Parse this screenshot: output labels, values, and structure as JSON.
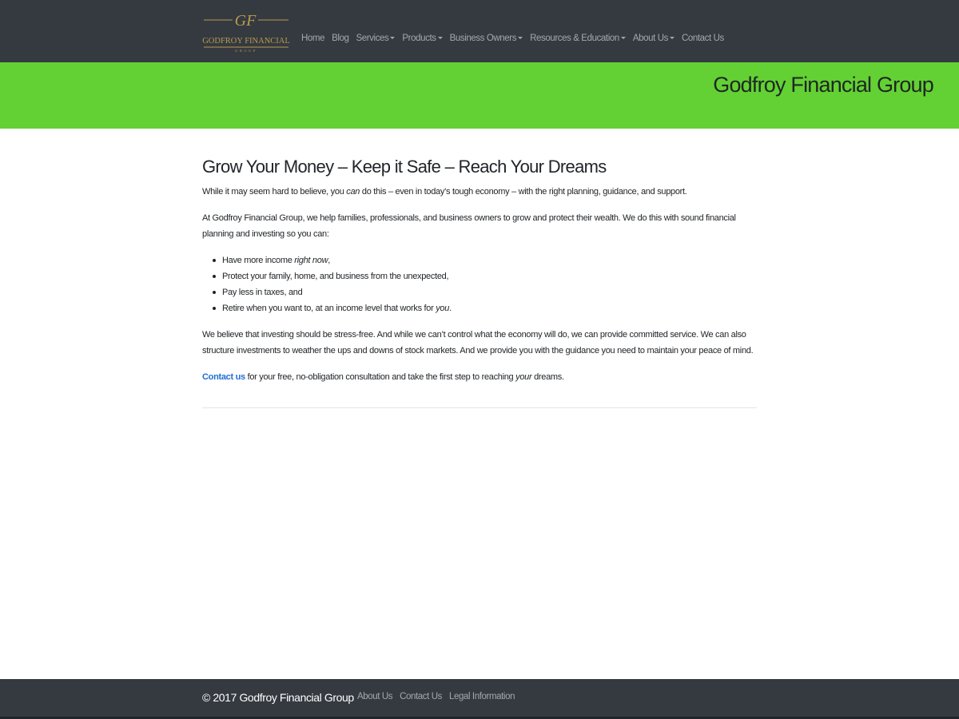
{
  "logo": {
    "monogram": "GF",
    "name": "GODFROY FINANCIAL",
    "sub": "GROUP",
    "gold": "#b99a4e"
  },
  "nav": {
    "items": [
      {
        "label": "Home",
        "dropdown": false
      },
      {
        "label": "Blog",
        "dropdown": false
      },
      {
        "label": "Services",
        "dropdown": true
      },
      {
        "label": "Products",
        "dropdown": true
      },
      {
        "label": "Business Owners",
        "dropdown": true
      },
      {
        "label": "Resources & Education",
        "dropdown": true
      },
      {
        "label": "About Us",
        "dropdown": true
      },
      {
        "label": "Contact Us",
        "dropdown": false
      }
    ]
  },
  "banner": {
    "title": "Godfroy Financial Group",
    "bg_color": "#63d133"
  },
  "main": {
    "heading": "Grow Your Money – Keep it Safe – Reach Your Dreams",
    "p1": {
      "a": "While it may seem hard to believe, you ",
      "em": "can",
      "b": " do this – even in today’s tough economy – with the right planning, guidance, and support."
    },
    "p2": "At Godfroy Financial Group, we help families, professionals, and business owners to grow and protect their wealth. We do this with sound financial planning and investing so you can:",
    "bullets": [
      {
        "a": "Have more income ",
        "em": "right now",
        "b": ","
      },
      {
        "a": "Protect your family, home, and business from the unexpected,",
        "em": "",
        "b": ""
      },
      {
        "a": "Pay less in taxes, and",
        "em": "",
        "b": ""
      },
      {
        "a": "Retire when you want to, at an income level that works for ",
        "em": "you",
        "b": "."
      }
    ],
    "p3": "We believe that investing should be stress-free. And while we can’t control what the economy will do, we can provide committed service. We can also structure investments to weather the ups and downs of stock markets. And we provide you with the guidance you need to maintain your peace of mind.",
    "p4": {
      "link": "Contact us",
      "a": " for your free, no-obligation consultation and take the first step to reaching ",
      "em": "your",
      "b": " dreams."
    }
  },
  "footer": {
    "copyright": "© 2017 Godfroy Financial Group",
    "links": [
      "About Us",
      "Contact Us",
      "Legal Information"
    ]
  },
  "colors": {
    "navbar_bg": "#343a40",
    "link_blue": "#1f6fd1"
  }
}
